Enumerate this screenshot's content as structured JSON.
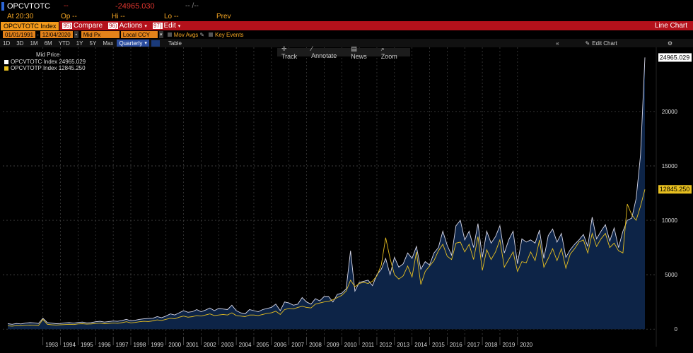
{
  "header": {
    "ticker": "OPCVTOTC",
    "change": "--",
    "last_price": "-24965.030",
    "change_range": "-- /--",
    "time_label": "At 20:30",
    "open_label": "Op --",
    "high_label": "Hi --",
    "low_label": "Lo --",
    "prev_label": "Prev"
  },
  "toolbar": {
    "security": "OPCVTOTC Index",
    "compare_num": "95)",
    "compare_label": "Compare",
    "actions_num": "96)",
    "actions_label": "Actions",
    "edit_num": "97)",
    "edit_label": "Edit",
    "view_title": "Line Chart"
  },
  "params": {
    "start_date": "01/01/1991",
    "end_date": "12/04/2020",
    "field": "Mid Px",
    "currency": "Local CCY",
    "mov_avgs": "Mov Avgs",
    "key_events": "Key Events"
  },
  "ranges": [
    "1D",
    "3D",
    "1M",
    "6M",
    "YTD",
    "1Y",
    "5Y",
    "Max"
  ],
  "frequency": "Quarterly",
  "table_label": "Table",
  "edit_chart_label": "Edit Chart",
  "collapse_icon": "double-chevron-left-icon",
  "settings_icon": "gear-icon",
  "tools": {
    "track": "Track",
    "annotate": "Annotate",
    "news": "News",
    "zoom": "Zoom"
  },
  "legend": {
    "title": "Mid Price",
    "items": [
      {
        "label": "OPCVTOTC Index 24965.029",
        "color": "#ffffff"
      },
      {
        "label": "OPCVTOTP Index 12845.250",
        "color": "#e8c020"
      }
    ]
  },
  "colors": {
    "background": "#000000",
    "area_fill": "#0d2447",
    "series1": "#d8d8e8",
    "series2": "#e8c020",
    "toolbar": "#b4111b",
    "accent_orange": "#f39a1b"
  },
  "chart_data": {
    "type": "area",
    "title": "",
    "xlabel": "",
    "ylabel": "",
    "ylim": [
      -700,
      25900
    ],
    "yticks": [
      0,
      5000,
      10000,
      15000,
      20000
    ],
    "xticks": [
      "1993",
      "1994",
      "1995",
      "1996",
      "1997",
      "1998",
      "1999",
      "2000",
      "2001",
      "2002",
      "2003",
      "2004",
      "2005",
      "2006",
      "2007",
      "2008",
      "2009",
      "2010",
      "2011",
      "2012",
      "2013",
      "2014",
      "2015",
      "2016",
      "2017",
      "2018",
      "2019",
      "2020"
    ],
    "x_start_year": 1991.0,
    "last_value_tags": [
      "24965.029",
      "12845.250"
    ],
    "series": [
      {
        "name": "OPCVTOTC Index",
        "values": [
          500,
          450,
          520,
          480,
          550,
          600,
          580,
          520,
          1000,
          600,
          550,
          500,
          520,
          580,
          600,
          550,
          620,
          650,
          580,
          600,
          680,
          720,
          650,
          700,
          750,
          720,
          800,
          900,
          760,
          820,
          900,
          950,
          980,
          1000,
          1150,
          1050,
          1200,
          1400,
          1300,
          1500,
          1700,
          1550,
          1600,
          1800,
          1600,
          1750,
          1950,
          1700,
          1900,
          1850,
          1800,
          2200,
          1700,
          1500,
          1400,
          1800,
          1700,
          1600,
          1800,
          1900,
          2000,
          2300,
          1700,
          2500,
          2400,
          2200,
          2300,
          2900,
          2500,
          2300,
          2800,
          2600,
          3000,
          3000,
          2500,
          3200,
          3300,
          3700,
          7200,
          3500,
          4300,
          4400,
          4500,
          4000,
          5000,
          5500,
          6500,
          5000,
          6600,
          5700,
          6000,
          7000,
          6500,
          7600,
          5500,
          6200,
          5900,
          7000,
          7500,
          9000,
          7700,
          6800,
          9500,
          10000,
          8200,
          9000,
          7500,
          9700,
          6600,
          9000,
          7900,
          8500,
          9500,
          7000,
          8200,
          9000,
          6000,
          8300,
          8000,
          8200,
          7900,
          9100,
          6500,
          8600,
          9200,
          8000,
          8800,
          6600,
          7300,
          7800,
          8200,
          8700,
          7600,
          10300,
          8300,
          9000,
          9600,
          8100,
          9300,
          7500,
          9000,
          10000,
          10200,
          12000,
          16000,
          24965
        ]
      },
      {
        "name": "OPCVTOTP Index",
        "values": [
          300,
          280,
          320,
          300,
          350,
          380,
          360,
          340,
          900,
          450,
          400,
          380,
          400,
          420,
          450,
          420,
          480,
          500,
          460,
          480,
          520,
          550,
          500,
          530,
          560,
          540,
          600,
          680,
          580,
          620,
          680,
          720,
          700,
          760,
          850,
          800,
          900,
          1000,
          950,
          1100,
          1200,
          1100,
          1150,
          1250,
          1200,
          1300,
          1400,
          1250,
          1300,
          1350,
          1300,
          1500,
          1250,
          1200,
          1150,
          1300,
          1300,
          1250,
          1350,
          1450,
          1500,
          1650,
          1350,
          1800,
          1900,
          1850,
          2000,
          2100,
          2000,
          1950,
          2300,
          2400,
          2500,
          2550,
          2700,
          2900,
          3100,
          3500,
          4500,
          3900,
          4200,
          4300,
          4200,
          4400,
          4900,
          5900,
          8400,
          6500,
          5000,
          4600,
          4900,
          5800,
          4800,
          7100,
          4100,
          5300,
          5800,
          6300,
          7200,
          7800,
          6700,
          6400,
          7900,
          8000,
          7100,
          7800,
          6400,
          8500,
          5400,
          7300,
          6400,
          7100,
          8200,
          5700,
          6400,
          7100,
          5300,
          6200,
          6100,
          7100,
          6300,
          8200,
          5700,
          6500,
          7400,
          6300,
          7400,
          5600,
          6900,
          7400,
          8000,
          8200,
          7000,
          8800,
          7600,
          8300,
          8800,
          7500,
          7900,
          7200,
          7000,
          11500,
          10500,
          10000,
          11300,
          12845
        ]
      }
    ]
  }
}
